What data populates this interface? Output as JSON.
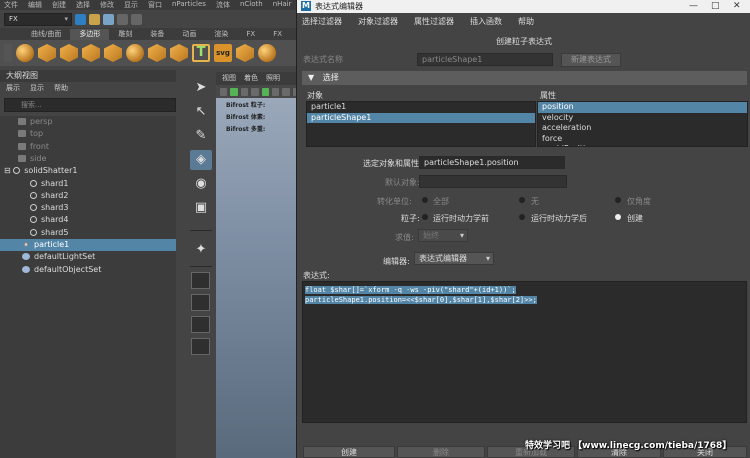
{
  "maya": {
    "menu": [
      "文件",
      "编辑",
      "创建",
      "选择",
      "修改",
      "显示",
      "窗口",
      "nParticles",
      "流体",
      "nCloth",
      "nHair"
    ],
    "mode": "FX",
    "shelf_tabs": [
      "曲线/曲面",
      "多边形",
      "雕刻",
      "装备",
      "动画",
      "渲染",
      "FX",
      "FX"
    ],
    "shelf_active": "多边形",
    "outliner": {
      "title": "大纲视图",
      "menu": [
        "展示",
        "显示",
        "帮助"
      ],
      "search_placeholder": "搜索...",
      "items": [
        "persp",
        "top",
        "front",
        "side",
        "solidShatter1",
        "shard1",
        "shard2",
        "shard3",
        "shard4",
        "shard5",
        "particle1",
        "defaultLightSet",
        "defaultObjectSet"
      ]
    },
    "viewport": {
      "menu": [
        "视图",
        "着色",
        "照明"
      ],
      "overlay": [
        "Bifrost 粒子:",
        "Bifrost 体素:",
        "Bifrost 多重:"
      ]
    }
  },
  "editor": {
    "title": "表达式编辑器",
    "menu": [
      "选择过滤器",
      "对象过滤器",
      "属性过滤器",
      "插入函数",
      "帮助"
    ],
    "create_title": "创建粒子表达式",
    "expr_name_label": "表达式名称",
    "expr_name_value": "particleShape1",
    "new_expr_button": "新建表达式",
    "selection_header": "选择",
    "objects_header": "对象",
    "objects": [
      "particle1",
      "particleShape1"
    ],
    "attributes_header": "属性",
    "attributes": [
      "position",
      "velocity",
      "acceleration",
      "force",
      "worldPosition"
    ],
    "selected_label": "选定对象和属性:",
    "selected_value": "particleShape1.position",
    "default_object_label": "默认对象:",
    "units_label": "转化单位:",
    "units_options": [
      "全部",
      "无",
      "仅角度"
    ],
    "particle_label": "粒子:",
    "particle_options": [
      "运行时动力学前",
      "运行时动力学后",
      "创建"
    ],
    "eval_label": "求值:",
    "eval_value": "始终",
    "editor_label": "编辑器:",
    "editor_value": "表达式编辑器",
    "expression_label": "表达式:",
    "code": [
      "float $shar[]=`xform -q -ws -piv(\"shard\"+(id+1))`;",
      "particleShape1.position=<<$shar[0],$shar[1],$shar[2]>>;"
    ],
    "buttons": [
      "创建",
      "删除",
      "重新加载",
      "清除",
      "关闭"
    ]
  },
  "watermark": "特效学习吧 【www.linecg.com/tieba/1768】"
}
